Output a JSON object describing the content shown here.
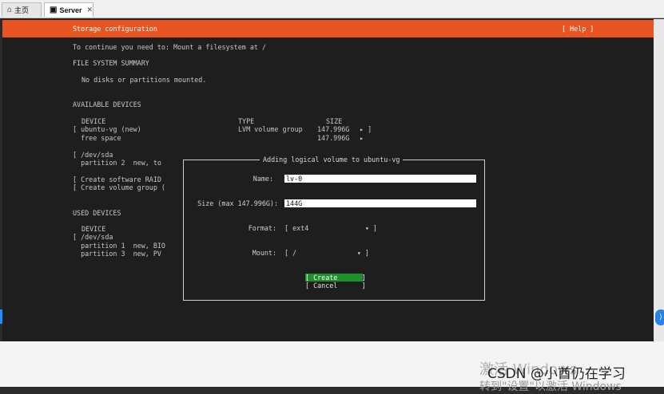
{
  "tabs": {
    "home": {
      "label": "主页"
    },
    "server": {
      "label": "Server"
    }
  },
  "header": {
    "title": "Storage configuration",
    "help": "[ Help ]"
  },
  "body": {
    "intro": "To continue you need to: Mount a filesystem at /",
    "fs_summary_title": "FILE SYSTEM SUMMARY",
    "fs_summary_text": "No disks or partitions mounted.",
    "available_title": "AVAILABLE DEVICES",
    "available_header": {
      "device": "DEVICE",
      "type": "TYPE",
      "size": "SIZE"
    },
    "available_rows": [
      {
        "device": "[ ubuntu-vg (new)",
        "type": "LVM volume group",
        "size": "147.996G",
        "action": "▸ ]"
      },
      {
        "device": "  free space",
        "type": "",
        "size": "147.996G",
        "action": "▸"
      },
      {
        "device": "[ /dev/sda",
        "type": "",
        "size": "",
        "action": ""
      },
      {
        "device": "  partition 2  new, to",
        "type": "",
        "size": "",
        "action": ""
      },
      {
        "device": "[ Create software RAID",
        "type": "",
        "size": "",
        "action": ""
      },
      {
        "device": "[ Create volume group (",
        "type": "",
        "size": "",
        "action": ""
      }
    ],
    "used_title": "USED DEVICES",
    "used_header": "DEVICE",
    "used_rows": [
      "[ /dev/sda",
      "  partition 1  new, BIO",
      "  partition 3  new, PV"
    ]
  },
  "dialog": {
    "title": "Adding logical volume to ubuntu-vg",
    "name_label": "Name:",
    "name_value": "lv-0",
    "size_label": "Size (max 147.996G):",
    "size_value": "144G",
    "format_label": "Format:",
    "format_value": "[ ext4              ▾ ]",
    "mount_label": "Mount:",
    "mount_value": "[ /               ▾ ]",
    "create": "[ Create      ]",
    "cancel": "[ Cancel      ]"
  },
  "watermark": {
    "activate": "激活 Windows",
    "csdn": "CSDN @小酋仍在学习",
    "goto": "转到\"设置\"以激活 Windows"
  }
}
